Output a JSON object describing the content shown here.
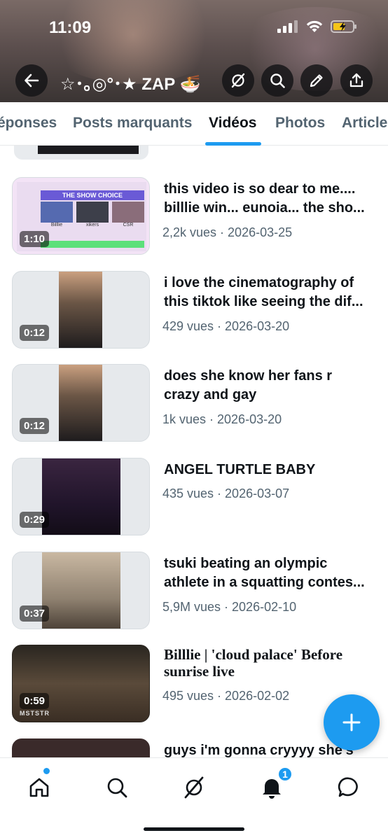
{
  "status_bar": {
    "time": "11:09"
  },
  "header": {
    "title": "☆･｡◎°･★ ZAP 🍜"
  },
  "tabs": [
    {
      "label": "éponses"
    },
    {
      "label": "Posts marquants"
    },
    {
      "label": "Vidéos",
      "active": true
    },
    {
      "label": "Photos"
    },
    {
      "label": "Article"
    }
  ],
  "videos": [
    {
      "duration": "1:10",
      "title_lines": [
        "this video is so dear to me....",
        "billlie win... eunoia... the sho..."
      ],
      "meta": "2,2k vues · 2026-03-25"
    },
    {
      "duration": "0:12",
      "title_lines": [
        "i love the cinematography of",
        "this tiktok like seeing the dif..."
      ],
      "meta": "429 vues · 2026-03-20"
    },
    {
      "duration": "0:12",
      "title_lines": [
        "does she know her fans r",
        "crazy and gay"
      ],
      "meta": "1k vues · 2026-03-20"
    },
    {
      "duration": "0:29",
      "title_lines": [
        "ANGEL TURTLE BABY"
      ],
      "meta": "435 vues · 2026-03-07"
    },
    {
      "duration": "0:37",
      "title_lines": [
        "tsuki beating an olympic",
        "athlete in a squatting contes..."
      ],
      "meta": "5,9M vues · 2026-02-10"
    },
    {
      "duration": "0:59",
      "title_lines": [
        "Billlie | 'cloud palace' Before",
        "sunrise live"
      ],
      "meta": "495 vues · 2026-02-02"
    },
    {
      "duration": "",
      "title_lines": [
        "guys i'm gonna cryyyy she's"
      ],
      "meta": ""
    }
  ],
  "thumb_text": {
    "show_choice": "THE SHOW CHOICE",
    "groups": [
      "Billlie",
      "xikers",
      "CSR"
    ],
    "watermark": "MSTSTR"
  },
  "notifications": {
    "badge": "1"
  },
  "colors": {
    "accent": "#1d9bf0",
    "text": "#0f1419",
    "secondary": "#536471"
  },
  "icons": [
    "back-arrow-icon",
    "grok-icon",
    "search-icon",
    "pencil-icon",
    "share-icon",
    "plus-icon",
    "home-icon",
    "explore-icon",
    "grok-nav-icon",
    "bell-icon",
    "messages-icon"
  ]
}
